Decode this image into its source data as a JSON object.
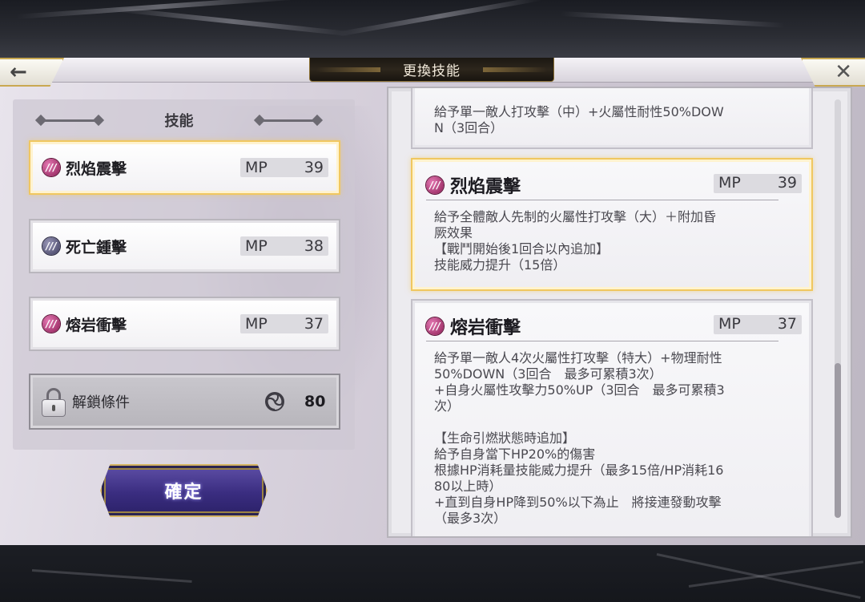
{
  "header": {
    "title": "更換技能",
    "back_icon": "back-arrow-icon",
    "close_icon": "close-icon",
    "back_glyph": "←",
    "close_glyph": "✕"
  },
  "skills_panel": {
    "header": "技能",
    "items": [
      {
        "name": "烈焰震擊",
        "mp_label": "MP",
        "mp": "39",
        "icon": "fire-element-icon",
        "selected": true
      },
      {
        "name": "死亡鍾擊",
        "mp_label": "MP",
        "mp": "38",
        "icon": "dark-element-icon",
        "selected": false
      },
      {
        "name": "熔岩衝擊",
        "mp_label": "MP",
        "mp": "37",
        "icon": "fire-element-icon",
        "selected": false
      }
    ],
    "unlock": {
      "label": "解鎖條件",
      "value": "80",
      "icon": "swirl-icon"
    },
    "confirm_label": "確定"
  },
  "details": {
    "cards": [
      {
        "desc": "給予單一敵人打攻擊（中）+火屬性耐性50%DOW\nN（3回合）"
      },
      {
        "name": "烈焰震擊",
        "mp_label": "MP",
        "mp": "39",
        "icon": "fire-element-icon",
        "desc": "給予全體敵人先制的火屬性打攻擊（大）＋附加昏\n厥效果\n【戰鬥開始後1回合以內追加】\n技能威力提升（15倍）"
      },
      {
        "name": "熔岩衝擊",
        "mp_label": "MP",
        "mp": "37",
        "icon": "fire-element-icon",
        "desc": "給予單一敵人4次火屬性打攻擊（特大）+物理耐性\n50%DOWN（3回合　最多可累積3次）\n+自身火屬性攻擊力50%UP（3回合　最多可累積3\n次）\n\n【生命引燃狀態時追加】\n給予自身當下HP20%的傷害\n根據HP消耗量技能威力提升（最多15倍/HP消耗16\n80以上時）\n+直到自身HP降到50%以下為止　將接連發動攻擊\n（最多3次）"
      }
    ]
  },
  "colors": {
    "selected_border": "#f0c760",
    "confirm_bg": "#3a2d80",
    "fire_icon": "#b8337a",
    "dark_icon": "#5a5878"
  }
}
